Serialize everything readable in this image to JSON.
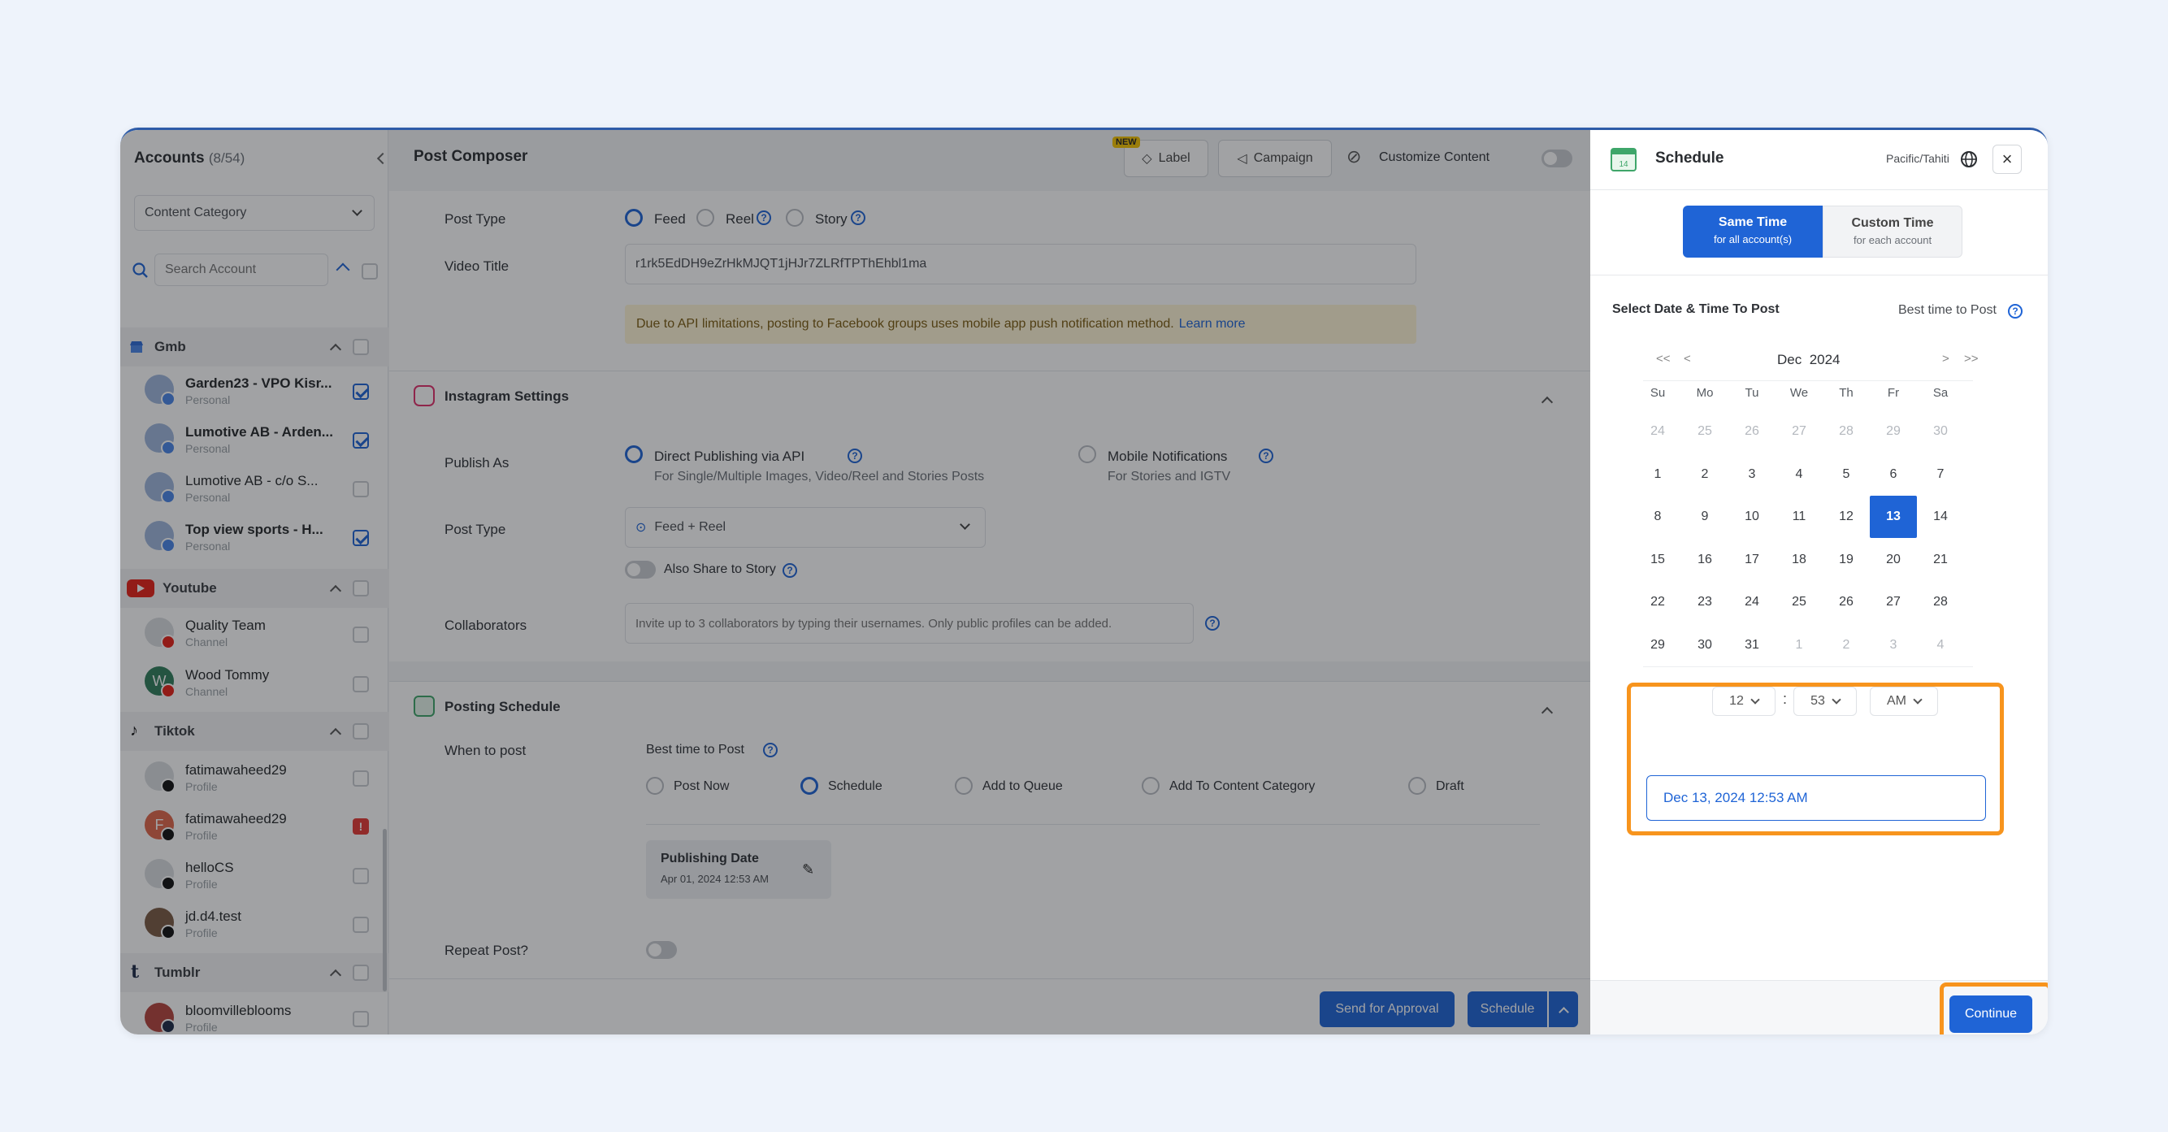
{
  "sidebar": {
    "title": "Accounts",
    "count": "(8/54)",
    "category_select": "Content Category",
    "search_placeholder": "Search Account",
    "groups": [
      {
        "name": "Gmb",
        "accounts": [
          {
            "name": "Garden23 - VPO Kisr...",
            "sub": "Personal",
            "checked": true
          },
          {
            "name": "Lumotive AB - Arden...",
            "sub": "Personal",
            "checked": true
          },
          {
            "name": "Lumotive AB - c/o S...",
            "sub": "Personal",
            "checked": false
          },
          {
            "name": "Top view sports - H...",
            "sub": "Personal",
            "checked": true
          }
        ]
      },
      {
        "name": "Youtube",
        "accounts": [
          {
            "name": "Quality Team",
            "sub": "Channel"
          },
          {
            "name": "Wood Tommy",
            "sub": "Channel",
            "initial": "W"
          }
        ]
      },
      {
        "name": "Tiktok",
        "accounts": [
          {
            "name": "fatimawaheed29",
            "sub": "Profile"
          },
          {
            "name": "fatimawaheed29",
            "sub": "Profile",
            "initial": "F",
            "error": "!"
          },
          {
            "name": "helloCS",
            "sub": "Profile"
          },
          {
            "name": "jd.d4.test",
            "sub": "Profile"
          }
        ]
      },
      {
        "name": "Tumblr",
        "accounts": [
          {
            "name": "bloomvilleblooms",
            "sub": "Profile"
          }
        ]
      }
    ]
  },
  "composer": {
    "title": "Post Composer",
    "new_badge": "NEW",
    "label_button": "Label",
    "campaign_button": "Campaign",
    "customize_content": "Customize Content",
    "post_type_label": "Post Type",
    "post_types": [
      "Feed",
      "Reel",
      "Story"
    ],
    "video_title_label": "Video Title",
    "video_title_value": "r1rk5EdDH9eZrHkMJQT1jHJr7ZLRfTPThEhbl1ma",
    "notice_text": "Due to API limitations, posting to Facebook groups uses mobile app push notification method.",
    "notice_link": "Learn more",
    "instagram_title": "Instagram Settings",
    "publish_as_label": "Publish As",
    "publish_option_1": "Direct Publishing via API",
    "publish_option_1_sub": "For Single/Multiple Images, Video/Reel and Stories Posts",
    "publish_option_2": "Mobile Notifications",
    "publish_option_2_sub": "For Stories and IGTV",
    "ig_post_type_label": "Post Type",
    "ig_post_type_value": "Feed + Reel",
    "also_share": "Also Share to Story",
    "collaborators_label": "Collaborators",
    "collaborators_placeholder": "Invite up to 3 collaborators by typing their usernames. Only public profiles can be added.",
    "posting_schedule_title": "Posting Schedule",
    "when_to_post_label": "When to post",
    "best_time": "Best time to Post",
    "when_options": [
      "Post Now",
      "Schedule",
      "Add to Queue",
      "Add To Content Category",
      "Draft"
    ],
    "publishing_date_title": "Publishing Date",
    "publishing_date_value": "Apr 01, 2024 12:53 AM",
    "repeat_post_label": "Repeat Post?",
    "send_for_approval": "Send for Approval",
    "schedule_button": "Schedule"
  },
  "schedule_panel": {
    "title": "Schedule",
    "timezone": "Pacific/Tahiti",
    "same_time_title": "Same Time",
    "same_time_sub": "for all account(s)",
    "custom_time_title": "Custom Time",
    "custom_time_sub": "for each account",
    "select_label": "Select Date & Time To Post",
    "best_time": "Best time to Post",
    "month": "Dec",
    "year": "2024",
    "nav": {
      "prev_year": "<<",
      "prev_month": "<",
      "next_month": ">",
      "next_year": ">>"
    },
    "weekdays": [
      "Su",
      "Mo",
      "Tu",
      "We",
      "Th",
      "Fr",
      "Sa"
    ],
    "days": [
      [
        "24",
        "25",
        "26",
        "27",
        "28",
        "29",
        "30"
      ],
      [
        "1",
        "2",
        "3",
        "4",
        "5",
        "6",
        "7"
      ],
      [
        "8",
        "9",
        "10",
        "11",
        "12",
        "13",
        "14"
      ],
      [
        "15",
        "16",
        "17",
        "18",
        "19",
        "20",
        "21"
      ],
      [
        "22",
        "23",
        "24",
        "25",
        "26",
        "27",
        "28"
      ],
      [
        "29",
        "30",
        "31",
        "1",
        "2",
        "3",
        "4"
      ]
    ],
    "selected_day": "13",
    "hour": "12",
    "time_separator": ":",
    "minute": "53",
    "meridiem": "AM",
    "datetime_value": "Dec 13, 2024 12:53 AM",
    "continue_button": "Continue"
  },
  "colors": {
    "accent": "#1f64d6",
    "highlight": "#f7941d",
    "notice_bg": "#fff6d6"
  }
}
